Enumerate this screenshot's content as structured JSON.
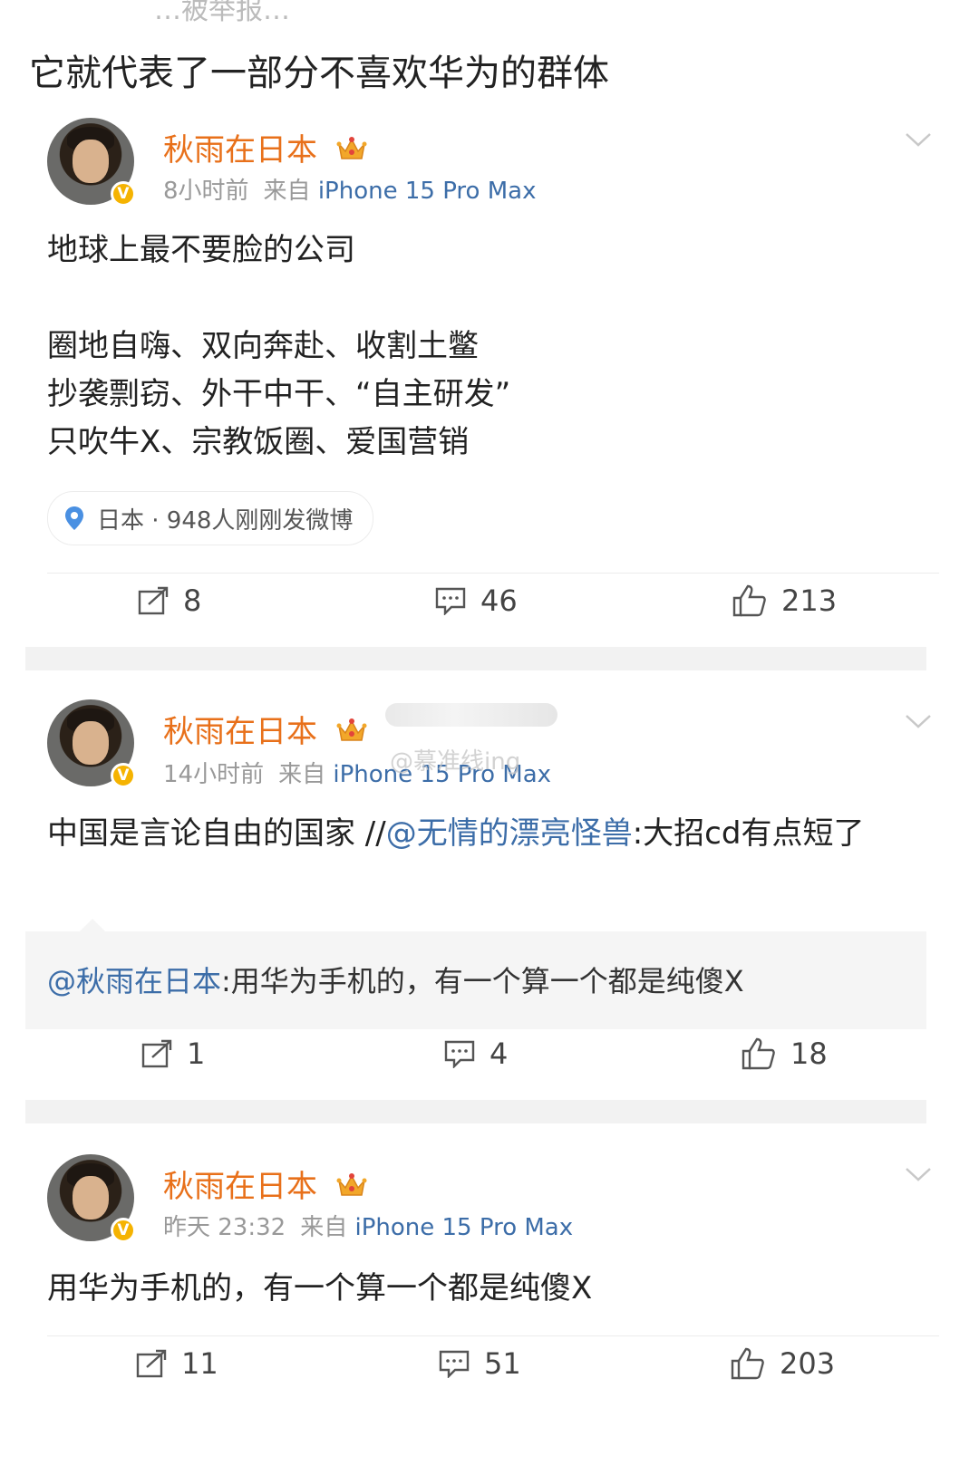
{
  "header": {
    "top_cut_text": "…被举报…",
    "title": "它就代表了一部分不喜欢华为的群体"
  },
  "posts": [
    {
      "username": "秋雨在日本",
      "time": "8小时前",
      "source_prefix": "来自",
      "device": "iPhone 15 Pro Max",
      "content_lines": [
        "地球上最不要脸的公司",
        "",
        "圈地自嗨、双向奔赴、收割土鳖",
        "抄袭剽窃、外干中干、“自主研发”",
        "只吹牛X、宗教饭圈、爱国营销"
      ],
      "location": "日本 · 948人刚刚发微博",
      "reposts": "8",
      "comments": "46",
      "likes": "213"
    },
    {
      "username": "秋雨在日本",
      "time": "14小时前",
      "source_prefix": "来自",
      "device": "iPhone 15 Pro Max",
      "content_prefix": "中国是言论自由的国家 //",
      "content_mention": "@无情的漂亮怪兽",
      "content_suffix": ":大招cd有点短了",
      "quote_mention": "@秋雨在日本",
      "quote_text": ":用华为手机的，有一个算一个都是纯傻X",
      "reposts": "1",
      "comments": "4",
      "likes": "18"
    },
    {
      "username": "秋雨在日本",
      "time": "昨天 23:32",
      "source_prefix": "来自",
      "device": "iPhone 15 Pro Max",
      "content": "用华为手机的，有一个算一个都是纯傻X",
      "reposts": "11",
      "comments": "51",
      "likes": "203"
    }
  ],
  "watermark": "@慕准线ing",
  "colors": {
    "username": "#e8701a",
    "link": "#3c6da8",
    "meta": "#999999",
    "verified_badge": "#f5b301"
  },
  "icons": {
    "repost": "repost-icon",
    "comment": "comment-icon",
    "like": "thumbs-up-icon",
    "location": "location-pin-icon",
    "more": "chevron-down-icon",
    "crown": "crown-icon"
  }
}
